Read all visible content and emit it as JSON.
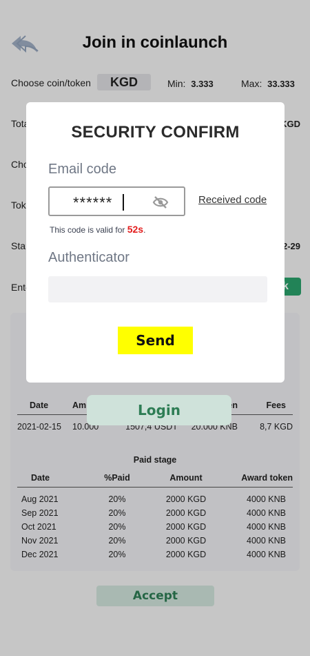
{
  "header": {
    "title": "Join in coinlaunch"
  },
  "choose_coin": {
    "label": "Choose coin/token",
    "value": "KGD",
    "min_label": "Min:",
    "min_value": "3.333",
    "max_label": "Max:",
    "max_value": "33.333"
  },
  "background_rows": {
    "total_label": "Tota",
    "total_tail": "KGD",
    "choose_label": "Cho",
    "token_label": "Tok",
    "start_label": "Star",
    "start_tail": "2-29",
    "enter_label": "Ente",
    "enter_btn_tail": "k"
  },
  "purchase_table": {
    "headers": [
      "Date",
      "Am",
      "",
      "en",
      "Fees"
    ],
    "row": [
      "2021-02-15",
      "10.000",
      "1507,4 USDT",
      "20.000 KNB",
      "8,7 KGD"
    ]
  },
  "login_button": "Login",
  "paid_stage": {
    "title": "Paid stage",
    "headers": [
      "Date",
      "%Paid",
      "Amount",
      "Award token"
    ],
    "rows": [
      [
        "Aug 2021",
        "20%",
        "2000 KGD",
        "4000 KNB"
      ],
      [
        "Sep 2021",
        "20%",
        "2000 KGD",
        "4000 KNB"
      ],
      [
        "Oct 2021",
        "20%",
        "2000 KGD",
        "4000 KNB"
      ],
      [
        "Nov 2021",
        "20%",
        "2000 KGD",
        "4000 KNB"
      ],
      [
        "Dec 2021",
        "20%",
        "2000 KGD",
        "4000 KNB"
      ]
    ]
  },
  "accept_button": "Accept",
  "modal": {
    "title": "SECURITY CONFIRM",
    "email_label": "Email code",
    "email_value": "******",
    "received_link": "Received code",
    "valid_prefix": "This code is valid for ",
    "valid_seconds": "52s",
    "valid_suffix": ".",
    "auth_label": "Authenticator",
    "auth_value": "",
    "send_button": "Send"
  },
  "colors": {
    "accent_green": "#2aa06b",
    "send_yellow": "#ffff00",
    "timer_red": "#e31c1c"
  },
  "icons": {
    "back": "double-arrow-back-icon",
    "eye": "eye-slash-icon"
  }
}
